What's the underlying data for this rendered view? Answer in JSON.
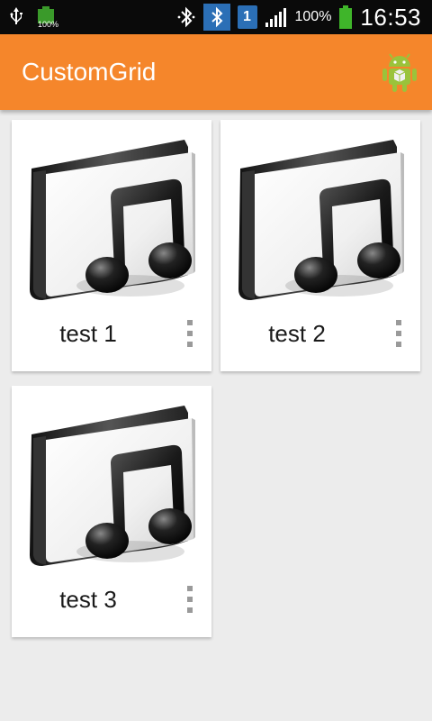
{
  "status_bar": {
    "battery_small_label": "100%",
    "sim_slot": "1",
    "battery_percent": "100%",
    "time": "16:53",
    "icons": [
      "usb-icon",
      "battery-charging-icon",
      "bluetooth-icon",
      "bluetooth-active-icon",
      "sim-icon",
      "signal-icon",
      "battery-icon"
    ]
  },
  "action_bar": {
    "title": "CustomGrid",
    "color": "#f5862b",
    "app_icon": "android-robot-icon"
  },
  "grid": {
    "items": [
      {
        "label": "test 1",
        "icon": "music-folder-icon",
        "menu": "overflow-menu-icon"
      },
      {
        "label": "test 2",
        "icon": "music-folder-icon",
        "menu": "overflow-menu-icon"
      },
      {
        "label": "test 3",
        "icon": "music-folder-icon",
        "menu": "overflow-menu-icon"
      }
    ]
  }
}
